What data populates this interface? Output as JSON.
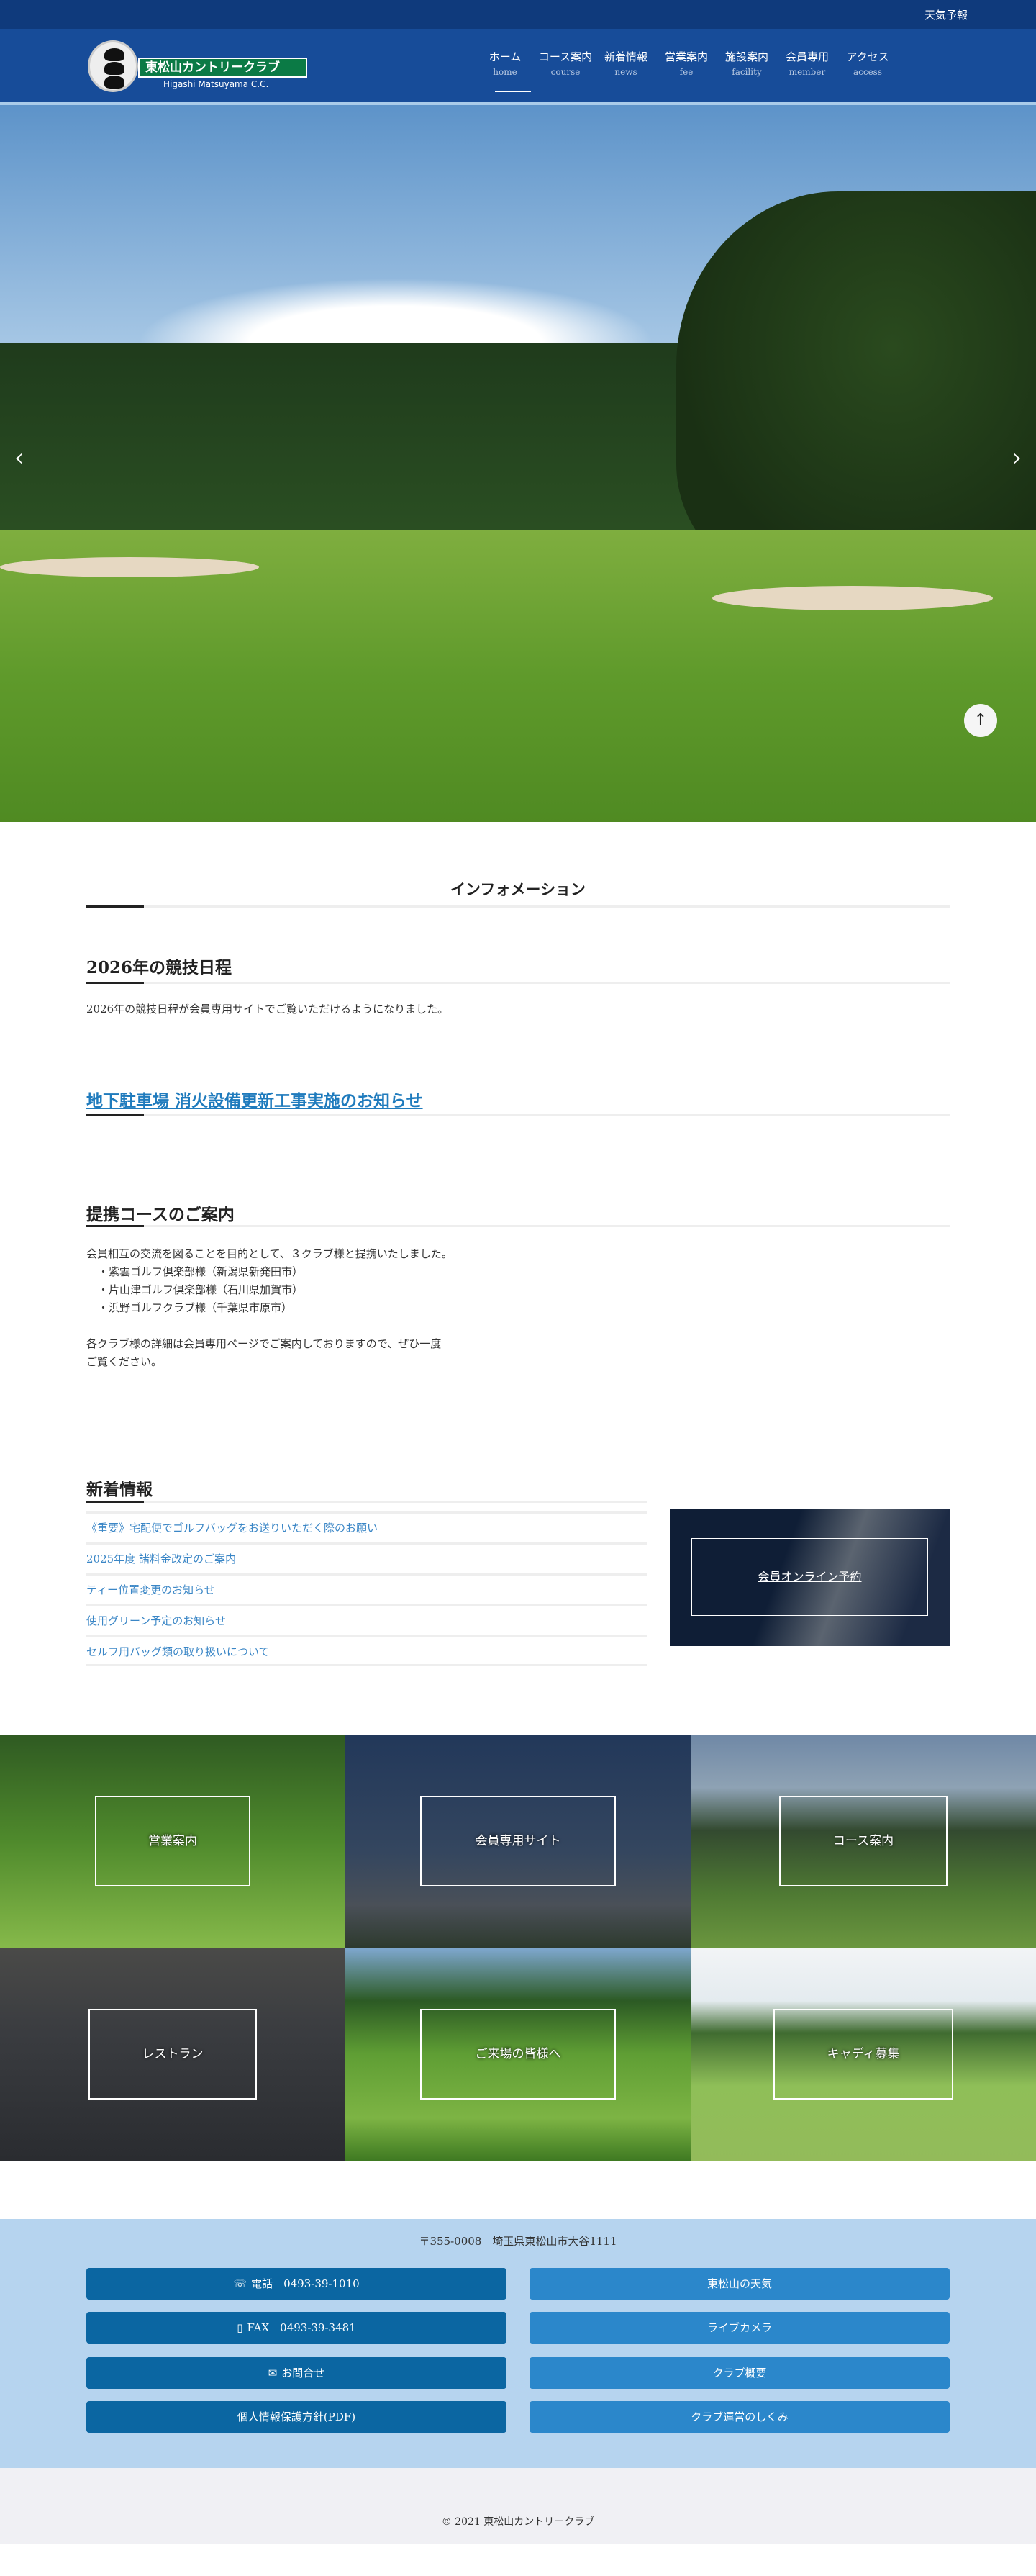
{
  "topbar": {
    "weather_link": "天気予報"
  },
  "logo": {
    "name": "東松山カントリークラブ",
    "name_en": "Higashi Matsuyama C.C."
  },
  "nav": [
    {
      "jp": "ホーム",
      "en": "home"
    },
    {
      "jp": "コース案内",
      "en": "course"
    },
    {
      "jp": "新着情報",
      "en": "news"
    },
    {
      "jp": "営業案内",
      "en": "fee"
    },
    {
      "jp": "施設案内",
      "en": "facility"
    },
    {
      "jp": "会員専用",
      "en": "member"
    },
    {
      "jp": "アクセス",
      "en": "access"
    }
  ],
  "hero": {
    "prev": "‹",
    "next": "›",
    "to_top": "↑"
  },
  "info": {
    "title": "インフォメーション",
    "items": [
      {
        "heading": "2026年の競技日程",
        "body": "2026年の競技日程が会員専用サイトでご覧いただけるようになりました。"
      },
      {
        "heading": "地下駐車場 消火設備更新工事実施のお知らせ"
      },
      {
        "heading": "提携コースのご案内",
        "lines": [
          "会員相互の交流を図ることを目的として、３クラブ様と提携いたしました。",
          "・紫雲ゴルフ倶楽部様（新潟県新発田市）",
          "・片山津ゴルフ倶楽部様（石川県加賀市）",
          "・浜野ゴルフクラブ様（千葉県市原市）",
          "各クラブ様の詳細は会員専用ページでご案内しておりますので、ぜひ一度",
          "ご覧ください。"
        ]
      }
    ]
  },
  "news": {
    "title": "新着情報",
    "items": [
      "《重要》宅配便でゴルフバッグをお送りいただく際のお願い",
      "2025年度 諸料金改定のご案内",
      "ティー位置変更のお知らせ",
      "使用グリーン予定のお知らせ",
      "セルフ用バッグ類の取り扱いについて"
    ],
    "booking": "会員オンライン予約"
  },
  "tiles": [
    "営業案内",
    "会員専用サイト",
    "コース案内",
    "レストラン",
    "ご来場の皆様へ",
    "キャディ募集"
  ],
  "footer": {
    "address": "〒355-0008　埼玉県東松山市大谷1111",
    "left": [
      {
        "icon": "☏",
        "label": "電話　0493-39-1010"
      },
      {
        "icon": "▯",
        "label": "FAX　0493-39-3481"
      },
      {
        "icon": "✉",
        "label": "お問合せ"
      },
      {
        "icon": "",
        "label": "個人情報保護方針(PDF)"
      }
    ],
    "right": [
      "東松山の天気",
      "ライブカメラ",
      "クラブ概要",
      "クラブ運営のしくみ"
    ],
    "copyright": "© 2021 東松山カントリークラブ"
  }
}
